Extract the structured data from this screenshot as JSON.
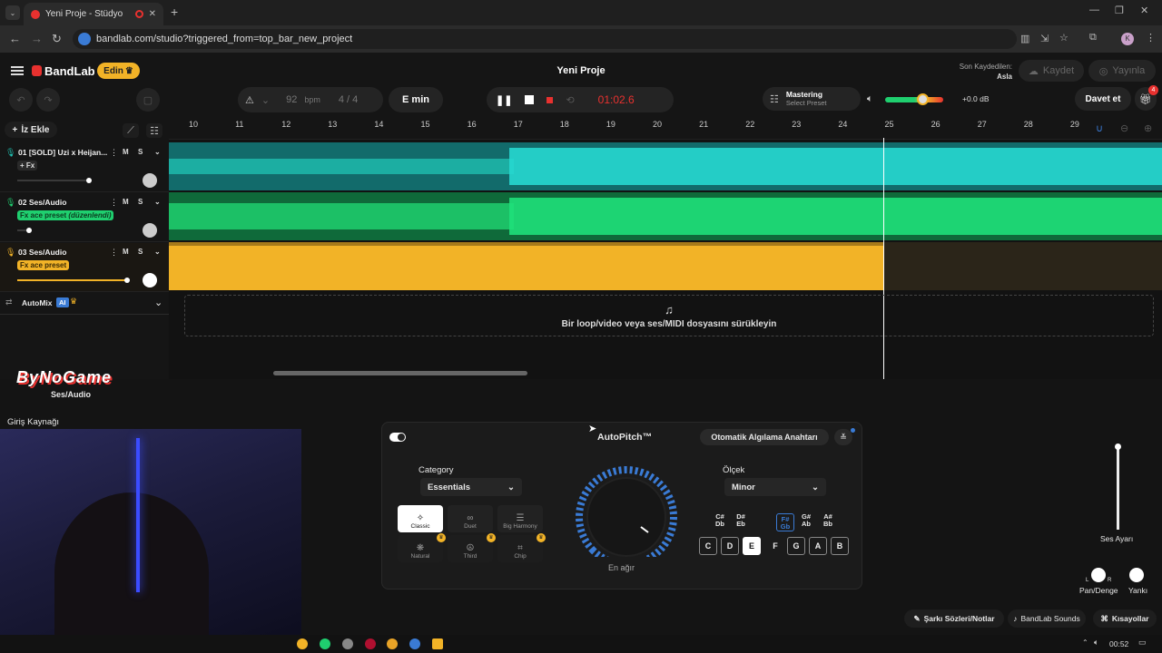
{
  "browser": {
    "tab_title": "Yeni Proje - Stüdyo",
    "url": "bandlab.com/studio?triggered_from=top_bar_new_project",
    "profile_initial": "K"
  },
  "header": {
    "logo": "BandLab",
    "edin_label": "Edin",
    "project_title": "Yeni Proje",
    "last_saved_label": "Son Kaydedilen:",
    "last_saved_value": "Asla",
    "save_label": "Kaydet",
    "publish_label": "Yayınla"
  },
  "toolbar": {
    "bpm_value": "92",
    "bpm_unit": "bpm",
    "time_sig_top": "4",
    "time_sig_sep": "/",
    "time_sig_bottom": "4",
    "key": "E min",
    "time": "01:02.6",
    "mastering_title": "Mastering",
    "mastering_preset": "Select Preset",
    "volume_db": "+0.0 dB",
    "invite_label": "Davet et",
    "gift_badge": "4"
  },
  "tracks_panel": {
    "add_track_label": "İz Ekle",
    "tracks": [
      {
        "num": "01",
        "name": "[SOLD] Uzi x Heijan...",
        "fx": "+ Fx",
        "m": "M",
        "s": "S",
        "color": "#1fbfb0"
      },
      {
        "num": "02",
        "name": "Ses/Audio",
        "fx": "Fx ace preset",
        "fx_note": "(düzenlendi)",
        "m": "M",
        "s": "S",
        "color": "#1fcf6f"
      },
      {
        "num": "03",
        "name": "Ses/Audio",
        "fx": "Fx ace preset",
        "m": "M",
        "s": "S",
        "color": "#f2b327"
      }
    ],
    "automix_label": "AutoMix",
    "ai_badge": "AI"
  },
  "ruler": [
    "10",
    "11",
    "12",
    "13",
    "14",
    "15",
    "16",
    "17",
    "18",
    "19",
    "20",
    "21",
    "22",
    "23",
    "24",
    "25",
    "26",
    "27",
    "28",
    "29"
  ],
  "dropzone_text": "Bir loop/video veya ses/MIDI dosyasını sürükleyin",
  "bottom": {
    "watermark": "ByNoGame",
    "track_label": "Ses/Audio",
    "input_source_label": "Giriş Kaynağı",
    "autopitch_title": "AutoPitch™",
    "auto_detect_label": "Otomatik Algılama Anahtarı",
    "category_label": "Category",
    "category_value": "Essentials",
    "fx_options": [
      "Classic",
      "Duet",
      "Big Harmony",
      "Natural",
      "Third",
      "Chip"
    ],
    "knob_label": "En ağır",
    "scale_label": "Ölçek",
    "scale_value": "Minor",
    "sharp_keys": [
      {
        "top": "C#",
        "bot": "Db"
      },
      {
        "top": "D#",
        "bot": "Eb"
      },
      {
        "top": "F#",
        "bot": "Gb"
      },
      {
        "top": "G#",
        "bot": "Ab"
      },
      {
        "top": "A#",
        "bot": "Bb"
      }
    ],
    "natural_keys": [
      "C",
      "D",
      "E",
      "F",
      "G",
      "A",
      "B"
    ],
    "volume_label": "Ses Ayarı",
    "pan_label": "Pan/Denge",
    "echo_label": "Yankı",
    "pan_l": "L",
    "pan_r": "R",
    "lyrics_label": "Şarkı Sözleri/Notlar",
    "sounds_label": "BandLab Sounds",
    "shortcuts_label": "Kısayollar"
  },
  "taskbar": {
    "time": "00:52"
  },
  "colors": {
    "accent_red": "#e8312f",
    "teal": "#1fbfb0",
    "green": "#1fcf6f",
    "orange": "#f2b327"
  }
}
